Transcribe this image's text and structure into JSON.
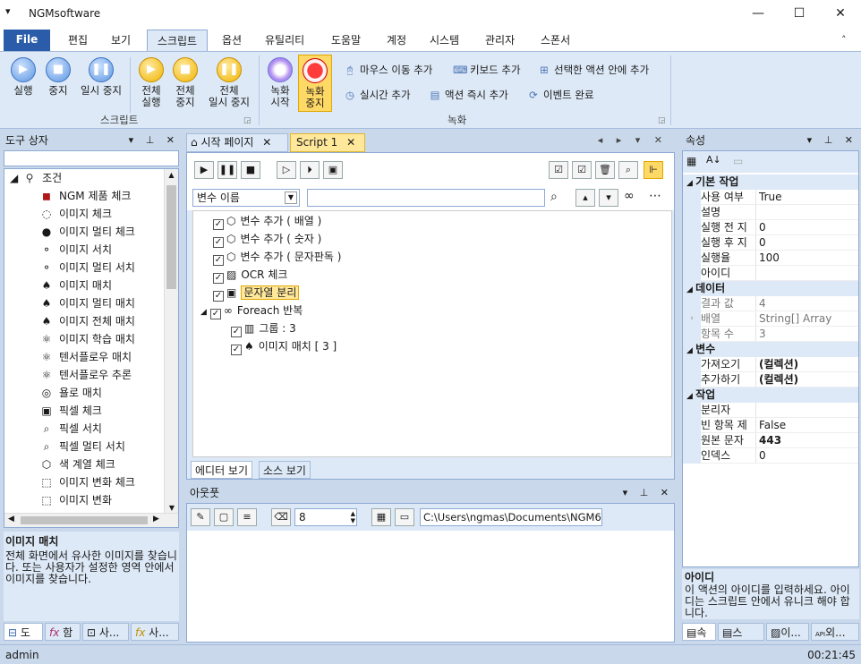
{
  "window": {
    "title": "NGMsoftware",
    "system_menu_glyph": "▾",
    "minimize": "—",
    "maximize": "☐",
    "close": "✕"
  },
  "menu": {
    "file": "File",
    "tabs": [
      "편집",
      "보기",
      "스크립트",
      "옵션",
      "유틸리티",
      "도움말",
      "계정",
      "시스템",
      "관리자",
      "스폰서"
    ],
    "collapse_glyph": "˄"
  },
  "ribbon": {
    "script_group": {
      "label": "스크립트",
      "buttons": [
        {
          "l1": "실행",
          "l2": "",
          "icon": "play-icon"
        },
        {
          "l1": "중지",
          "l2": "",
          "icon": "stop-icon"
        },
        {
          "l1": "일시 중지",
          "l2": "",
          "icon": "pause-icon"
        },
        {
          "l1": "전체",
          "l2": "실행",
          "icon": "play-all-icon"
        },
        {
          "l1": "전체",
          "l2": "중지",
          "icon": "stop-all-icon"
        },
        {
          "l1": "전체",
          "l2": "일시 중지",
          "icon": "pause-all-icon"
        }
      ]
    },
    "record_group": {
      "label": "녹화",
      "record_start": {
        "l1": "녹화",
        "l2": "시작"
      },
      "record_stop": {
        "l1": "녹화",
        "l2": "중지"
      },
      "row1": [
        "마우스 이동 추가",
        "키보드 추가",
        "선택한 액션 안에 추가"
      ],
      "row2": [
        "실시간 추가",
        "액션 즉시 추가",
        "이벤트 완료"
      ]
    }
  },
  "toolbox": {
    "title": "도구 상자",
    "search_value": "",
    "category": "조건",
    "items": [
      "NGM 제품 체크",
      "이미지 체크",
      "이미지 멀티 체크",
      "이미지 서치",
      "이미지 멀티 서치",
      "이미지 매치",
      "이미지 멀티 매치",
      "이미지 전체 매치",
      "이미지 학습 매치",
      "텐서플로우 매치",
      "텐서플로우 추론",
      "욜로 매치",
      "픽셀 체크",
      "픽셀 서치",
      "픽셀 멀티 서치",
      "색 계열 체크",
      "이미지 변화 체크",
      "이미지 변화"
    ],
    "desc_title": "이미지 매치",
    "desc_text": "전체 화면에서 유사한 이미지를 찾습니다. 또는 사용자가 설정한 영역 안에서 이미지를 찾습니다.",
    "bottom_tabs": [
      "도",
      "함",
      "사...",
      "사..."
    ]
  },
  "editor": {
    "tabs": [
      {
        "label": "시작 페이지"
      },
      {
        "label": "Script 1"
      }
    ],
    "variable_select": "변수 이름",
    "filter_value": "",
    "tree": [
      {
        "label": "변수 추가 ( 배열 )",
        "level": 0
      },
      {
        "label": "변수 추가 ( 숫자 )",
        "level": 0
      },
      {
        "label": "변수 추가 ( 문자판독 )",
        "level": 0
      },
      {
        "label": "OCR 체크",
        "level": 0
      },
      {
        "label": "문자열 분리",
        "level": 0,
        "selected": true
      },
      {
        "label": "Foreach 반복",
        "level": 0,
        "expanded": true
      },
      {
        "label": "그룹 : 3",
        "level": 1
      },
      {
        "label": "이미지 매치 [ 3 ]",
        "level": 1
      }
    ],
    "bottom_tabs": [
      "에디터 보기",
      "소스 보기"
    ]
  },
  "output": {
    "title": "아웃풋",
    "number": "8",
    "path": "C:\\Users\\ngmas\\Documents\\NGM6\\"
  },
  "properties": {
    "title": "속성",
    "categories": [
      {
        "name": "기본 작업",
        "rows": [
          [
            "사용 여부",
            "True"
          ],
          [
            "설명",
            ""
          ],
          [
            "실행 전 지",
            "0"
          ],
          [
            "실행 후 지",
            "0"
          ],
          [
            "실행율",
            "100"
          ],
          [
            "아이디",
            ""
          ]
        ]
      },
      {
        "name": "데이터",
        "rows": [
          [
            "결과 값",
            "4"
          ],
          [
            "배열",
            "String[] Array"
          ],
          [
            "항목 수",
            "3"
          ]
        ]
      },
      {
        "name": "변수",
        "rows": [
          [
            "가져오기",
            "(컬렉션)"
          ],
          [
            "추가하기",
            "(컬렉션)"
          ]
        ]
      },
      {
        "name": "작업",
        "rows": [
          [
            "분리자",
            ""
          ],
          [
            "빈 항목 제",
            "False"
          ],
          [
            "원본 문자",
            "443"
          ],
          [
            "인덱스",
            "0"
          ]
        ]
      }
    ],
    "desc_title": "아이디",
    "desc_text": "이 액션의 아이디를 입력하세요. 아이디는 스크립트 안에서 유니크 해야 합니다.",
    "bottom_tabs": [
      "속",
      "스크...",
      "이...",
      "외..."
    ]
  },
  "status": {
    "user": "admin",
    "time": "00:21:45"
  }
}
